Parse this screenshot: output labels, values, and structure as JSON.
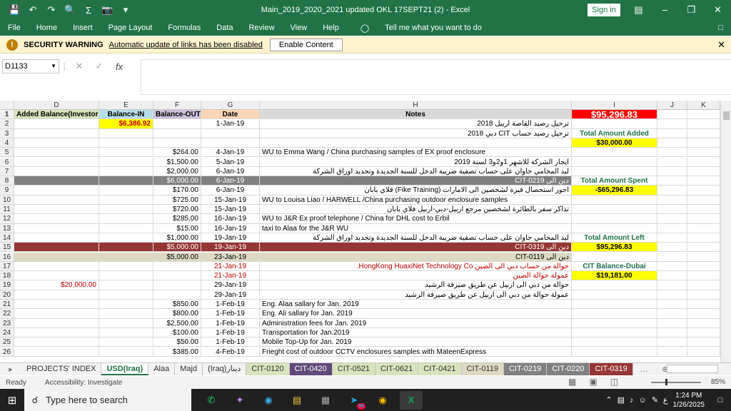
{
  "window": {
    "title": "Main_2019_2020_2021 updated OKL 17SEPT21 (2)  -  Excel",
    "sign_in": "Sign in",
    "quick_access": [
      "save-icon",
      "undo-icon",
      "redo-icon",
      "print-preview-icon",
      "sum-icon",
      "camera-icon",
      "customize-icon"
    ],
    "controls": [
      "ribbon-display-icon",
      "minimize-icon",
      "restore-icon",
      "close-icon"
    ]
  },
  "ribbon": {
    "tabs": [
      "File",
      "Home",
      "Insert",
      "Page Layout",
      "Formulas",
      "Data",
      "Review",
      "View",
      "Help"
    ],
    "tell_me": "Tell me what you want to do"
  },
  "security": {
    "title": "SECURITY WARNING",
    "message": "Automatic update of links has been disabled",
    "button": "Enable Content"
  },
  "formula_bar": {
    "name_box": "D1133",
    "fx": "fx",
    "value": ""
  },
  "columns": [
    "D",
    "E",
    "F",
    "G",
    "H",
    "I",
    "J",
    "K"
  ],
  "header_row": {
    "D": "Added Balance(Investors)",
    "E": "Balance-IN",
    "F": "Balance-OUT",
    "G": "Date",
    "H": "Notes",
    "I": "$95,296.83"
  },
  "rows": [
    {
      "n": "2",
      "E": "$6,386.92",
      "G": "1-Jan-19",
      "H": "ترحيل رصيد القاصة اربيل 2018"
    },
    {
      "n": "3",
      "H": "ترحيل رصيد حساب CIT  دبي 2018",
      "I": "Total Amount Added"
    },
    {
      "n": "4",
      "I": "$30,000.00"
    },
    {
      "n": "5",
      "F": "$264.00",
      "G": "4-Jan-19",
      "H": "WU to Emma Wang / China purchasing samples of EX proof enclosure"
    },
    {
      "n": "6",
      "F": "$1,500.00",
      "G": "5-Jan-19",
      "H": "ايجار الشركة للاشهر 1و2و3  لسنة 2019"
    },
    {
      "n": "7",
      "F": "$2,000.00",
      "G": "6-Jan-19",
      "H": "ليد المحامي جاوان على حساب تصفية ضريبة الدخل للسنة الجديدة وتجديد اوراق الشركة"
    },
    {
      "n": "8",
      "F": "$6,000.00",
      "G": "6-Jan-19",
      "H": "دين الى CIT-0219",
      "I": "Total Amount Spent"
    },
    {
      "n": "9",
      "F": "$170.00",
      "G": "6-Jan-19",
      "H": "اجور استحصال فيزة لشخصين الى الامارات (Fike Training)   فلاي بابان",
      "I": "-$65,296.83"
    },
    {
      "n": "10",
      "F": "$725.00",
      "G": "15-Jan-19",
      "H": "WU to Louisa Liao / HARWELL /China purchasing outdoor enclosure samples"
    },
    {
      "n": "11",
      "F": "$720.00",
      "G": "15-Jan-19",
      "H": "تذاكر سفر بالطائرة لشخصين مرجع اربيل-دبي-اربيل      فلاي بابان"
    },
    {
      "n": "12",
      "F": "$285.00",
      "G": "16-Jan-19",
      "H": "WU to J&R  Ex proof telephone / China      for DHL cost to Erbil"
    },
    {
      "n": "13",
      "F": "$15.00",
      "G": "16-Jan-19",
      "H": "taxi to Alaa for the J&R WU"
    },
    {
      "n": "14",
      "F": "$1,000.00",
      "G": "19-Jan-19",
      "H": "ليد المحامي جاوان على حساب تصفية ضريبة الدخل للسنة الجديدة وتجديد اوراق الشركة",
      "I": "Total Amount Left"
    },
    {
      "n": "15",
      "F": "$5,000.00",
      "G": "19-Jan-19",
      "H": "دين الى CIT-0319",
      "I": "$95,296.83"
    },
    {
      "n": "16",
      "F": "$5,000.00",
      "G": "23-Jan-19",
      "H": "دين الى CIT-0119"
    },
    {
      "n": "17",
      "G": "21-Jan-19",
      "H": "حوالة من حساب دبي الى الصين HongKong HuaxiNet Technology Co.",
      "I": "CIT Balance-Dubai"
    },
    {
      "n": "18",
      "G": "21-Jan-19",
      "H": "عمولة حوالة الصين",
      "I": "$19,181.00"
    },
    {
      "n": "19",
      "D": "$20,000.00",
      "G": "29-Jan-19",
      "H": "حوالة من دبي الى اربيل عن طريق صيرفة الرشيد"
    },
    {
      "n": "20",
      "G": "29-Jan-19",
      "H": "عمولة حوالة من دبي الى اربيل عن طريق صيرفة الرشيد"
    },
    {
      "n": "21",
      "F": "$850.00",
      "G": "1-Feb-19",
      "H": "Eng. Alaa sallary for Jan. 2019"
    },
    {
      "n": "22",
      "F": "$800.00",
      "G": "1-Feb-19",
      "H": "Eng. Ali sallary for Jan. 2019"
    },
    {
      "n": "23",
      "F": "$2,500.00",
      "G": "1-Feb-19",
      "H": "Administration fees for Jan. 2019"
    },
    {
      "n": "24",
      "F": "$100.00",
      "G": "1-Feb-19",
      "H": "Transportation for Jan.2019"
    },
    {
      "n": "25",
      "F": "$50.00",
      "G": "1-Feb-19",
      "H": "Mobile Top-Up for Jan. 2019"
    },
    {
      "n": "26",
      "F": "$385.00",
      "G": "4-Feb-19",
      "H": "Frieght cost of outdoor CCTV enclosures samples with MateenExpress"
    }
  ],
  "sheet_tabs": [
    "PROJECTS' INDEX",
    "USD(Iraq)",
    "Alaa",
    "Majd",
    "(Iraq)دينار",
    "CIT-0120",
    "CIT-0420",
    "CIT-0521",
    "CIT-0621",
    "CIT-0421",
    "CIT-0119",
    "CIT-0219",
    "CIT-0220",
    "CIT-0319"
  ],
  "sheet_tab_colors": {
    "CIT-0120": "#d8e4bc",
    "CIT-0420": "#60497a",
    "CIT-0521": "#d8e4bc",
    "CIT-0621": "#d8e4bc",
    "CIT-0421": "#d8e4bc",
    "CIT-0119": "#ddd9c4",
    "CIT-0219": "#808080",
    "CIT-0220": "#808080",
    "CIT-0319": "#963634"
  },
  "active_tab": "USD(Iraq)",
  "status": {
    "ready": "Ready",
    "accessibility": "Accessibility: Investigate",
    "zoom": "85%"
  },
  "taskbar": {
    "search_placeholder": "Type here to search",
    "time": "1:24 PM",
    "date": "1/26/2025",
    "lang": "ع",
    "badge": "90"
  },
  "colors": {
    "excel_green": "#217346",
    "header_green": "#d8e4bc",
    "header_blue": "#b7dee8",
    "header_purple": "#ccc0da",
    "header_orange": "#fcd5b4",
    "total_red": "#ff0000",
    "highlight_yellow": "#ffff00"
  }
}
